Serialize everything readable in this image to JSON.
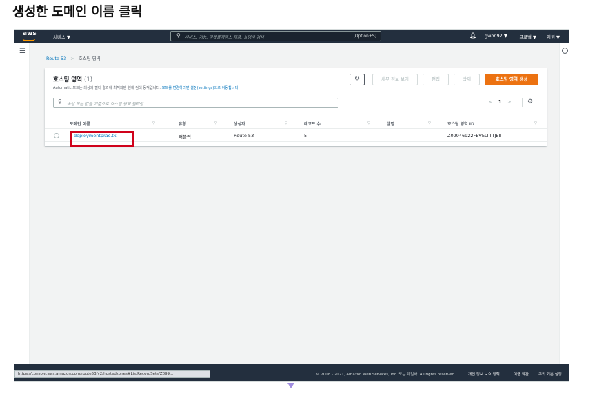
{
  "heading": "생성한 도메인 이름 클릭",
  "topnav": {
    "logo": "aws",
    "services": "서비스 ▼",
    "search_icon": "search-icon",
    "search_placeholder": "서비스, 기능, 마켓플레이스 제품, 설명서 검색",
    "search_shortcut": "[Option+S]",
    "bell_icon": "bell-icon",
    "user": "gwon92 ▼",
    "region": "글로벌 ▼",
    "support": "지원 ▼"
  },
  "breadcrumb": {
    "root": "Route 53",
    "separator": ">",
    "current": "호스팅 영역"
  },
  "panel": {
    "title": "호스팅 영역",
    "count": "(1)",
    "desc_prefix": "Automatic 모드는 최상의 필터 결과에 최적화된 현재 검색 동작입니다.",
    "desc_link": "모드를 변경하려면 설정(settings)으로 이동합니다.",
    "buttons": {
      "refresh": "↻",
      "details": "세부 정보 보기",
      "edit": "편집",
      "delete": "삭제",
      "create": "호스팅 영역 생성"
    },
    "filter_placeholder": "속성 또는 값을 기준으로 호스팅 영역 필터링",
    "pager": {
      "prev": "<",
      "page": "1",
      "next": ">"
    },
    "settings_icon": "gear-icon",
    "columns": [
      "도메인 이름",
      "유형",
      "생성자",
      "레코드 수",
      "설명",
      "호스팅 영역 ID"
    ],
    "sort_glyph": "▽",
    "rows": [
      {
        "domain": "deploymentprac.tk",
        "type": "퍼블릭",
        "created_by": "Route 53",
        "records": "5",
        "description": "-",
        "zone_id": "Z09946922FEVELTTTJEII"
      }
    ]
  },
  "footer": {
    "copyright": "© 2008 - 2021, Amazon Web Services, Inc. 또는 계열사. All rights reserved.",
    "privacy": "개인 정보 보호 정책",
    "terms": "이용 약관",
    "cookies": "쿠키 기본 설정"
  },
  "statusbar_url": "https://console.aws.amazon.com/route53/v2/hostedzones#ListRecordSets/Z099...",
  "colors": {
    "nav": "#232f3e",
    "accent": "#ec7211",
    "link": "#0073bb",
    "highlight": "#d0021b"
  }
}
